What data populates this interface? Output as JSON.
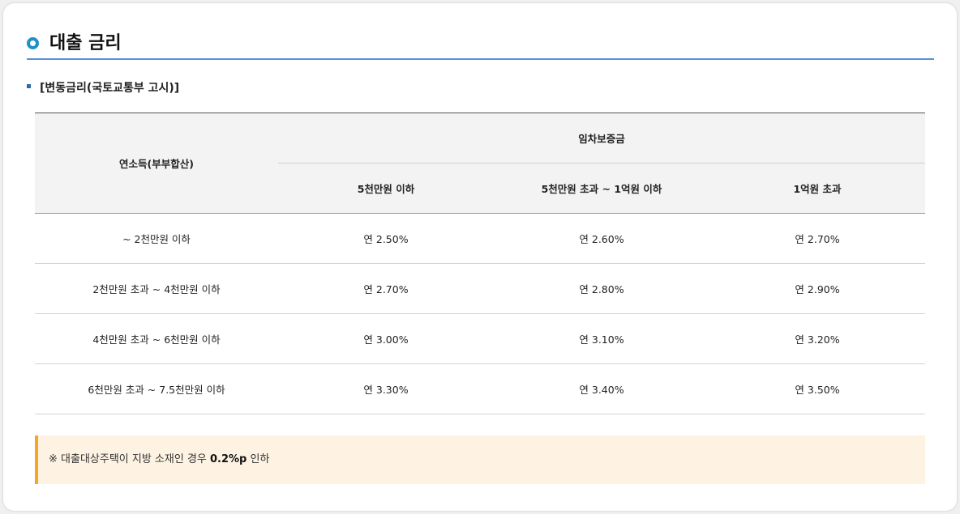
{
  "section": {
    "title": "대출 금리"
  },
  "subsection": {
    "title": "[변동금리(국토교통부 고시)]"
  },
  "rate_table": {
    "row_header": "연소득(부부합산)",
    "group_header": "임차보증금",
    "columns": [
      "5천만원 이하",
      "5천만원 초과 ~ 1억원 이하",
      "1억원 초과"
    ],
    "rows": [
      {
        "label": "~ 2천만원 이하",
        "values": [
          "연 2.50%",
          "연 2.60%",
          "연 2.70%"
        ]
      },
      {
        "label": "2천만원 초과 ~ 4천만원 이하",
        "values": [
          "연 2.70%",
          "연 2.80%",
          "연 2.90%"
        ]
      },
      {
        "label": "4천만원 초과 ~ 6천만원 이하",
        "values": [
          "연 3.00%",
          "연 3.10%",
          "연 3.20%"
        ]
      },
      {
        "label": "6천만원 초과 ~ 7.5천만원 이하",
        "values": [
          "연 3.30%",
          "연 3.40%",
          "연 3.50%"
        ]
      }
    ]
  },
  "note": {
    "prefix": "※ 대출대상주택이 지방 소재인 경우 ",
    "highlight": "0.2%p",
    "suffix": " 인하"
  },
  "colors": {
    "accent_blue": "#1e90c8",
    "header_underline": "#5b8fd9",
    "note_background": "#fef3e2",
    "note_border": "#f5a623"
  }
}
